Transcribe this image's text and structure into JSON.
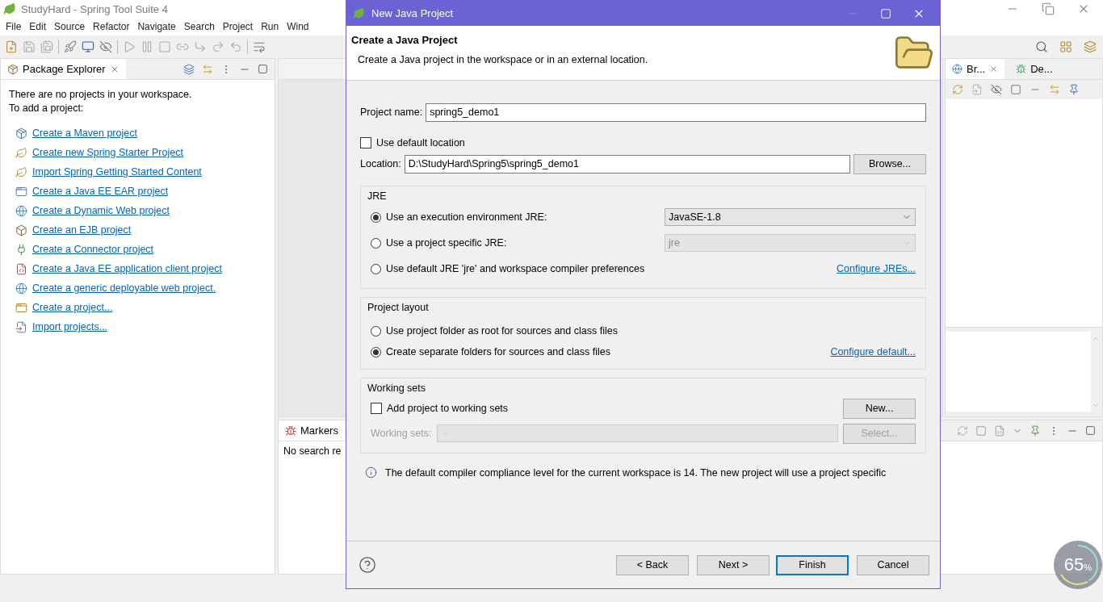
{
  "ide": {
    "title": "StudyHard - Spring Tool Suite 4",
    "menu": [
      "File",
      "Edit",
      "Source",
      "Refactor",
      "Navigate",
      "Search",
      "Project",
      "Run",
      "Wind"
    ],
    "package_explorer": {
      "tab": "Package Explorer",
      "message": [
        "There are no projects in your workspace.",
        "To add a project:"
      ],
      "links": [
        "Create a Maven project",
        "Create new Spring Starter Project",
        "Import Spring Getting Started Content",
        "Create a Java EE EAR project",
        "Create a Dynamic Web project",
        "Create an EJB project",
        "Create a Connector project",
        "Create a Java EE application client project",
        "Create a generic deployable web project.",
        "Create a project...",
        "Import projects..."
      ]
    },
    "right_tabs": [
      {
        "label": "Br...",
        "selected": true
      },
      {
        "label": "De...",
        "selected": false
      }
    ],
    "markers": {
      "tab": "Markers",
      "message": "No search re"
    },
    "memory": {
      "value": "65",
      "unit": "%"
    }
  },
  "dialog": {
    "title": "New Java Project",
    "heading": "Create a Java Project",
    "description": "Create a Java project in the workspace or in an external location.",
    "project_name": {
      "label": "Project name:",
      "value": "spring5_demo1"
    },
    "use_default_location": {
      "label": "Use default location",
      "checked": false
    },
    "location": {
      "label": "Location:",
      "value": "D:\\StudyHard\\Spring5\\spring5_demo1",
      "button": "Browse..."
    },
    "jre": {
      "title": "JRE",
      "options": [
        {
          "label": "Use an execution environment JRE:",
          "selected": true,
          "select": {
            "value": "JavaSE-1.8",
            "disabled": false
          }
        },
        {
          "label": "Use a project specific JRE:",
          "selected": false,
          "select": {
            "value": "jre",
            "disabled": true
          }
        },
        {
          "label": "Use default JRE 'jre' and workspace compiler preferences",
          "selected": false,
          "link": "Configure JREs..."
        }
      ]
    },
    "layout": {
      "title": "Project layout",
      "options": [
        {
          "label": "Use project folder as root for sources and class files",
          "selected": false
        },
        {
          "label": "Create separate folders for sources and class files",
          "selected": true,
          "link": "Configure default..."
        }
      ]
    },
    "working_sets": {
      "title": "Working sets",
      "checkbox": {
        "label": "Add project to working sets",
        "checked": false
      },
      "new_button": "New...",
      "field_label": "Working sets:",
      "disabled": true,
      "select_button": "Select..."
    },
    "info": "The default compiler compliance level for the current workspace is 14. The new project will use a project specific",
    "buttons": [
      {
        "label": "< Back",
        "default": false
      },
      {
        "label": "Next >",
        "default": false
      },
      {
        "label": "Finish",
        "default": true
      },
      {
        "label": "Cancel",
        "default": false
      }
    ]
  }
}
